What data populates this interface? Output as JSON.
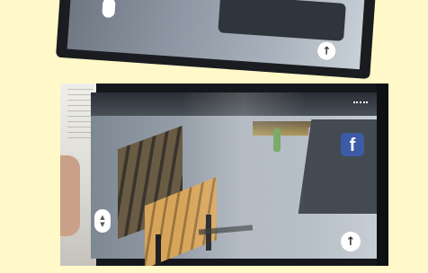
{
  "top_photo": {
    "joystick_icon": "move-joystick-icon",
    "action_icon": "arrow-up-icon",
    "action_glyph": "↑"
  },
  "tablet": {
    "facebook_icon": "facebook-icon",
    "facebook_glyph": "f",
    "joystick_icon": "move-joystick-icon",
    "joystick_up": "▲",
    "joystick_down": "▼",
    "action_icon": "arrow-up-icon",
    "action_glyph": "↑",
    "status_icon": "status-dots-icon"
  },
  "colors": {
    "background": "#fff9c9",
    "facebook": "#3b5ba7",
    "bench_seat": "#d7a55a",
    "stripe": "#e0342d"
  }
}
